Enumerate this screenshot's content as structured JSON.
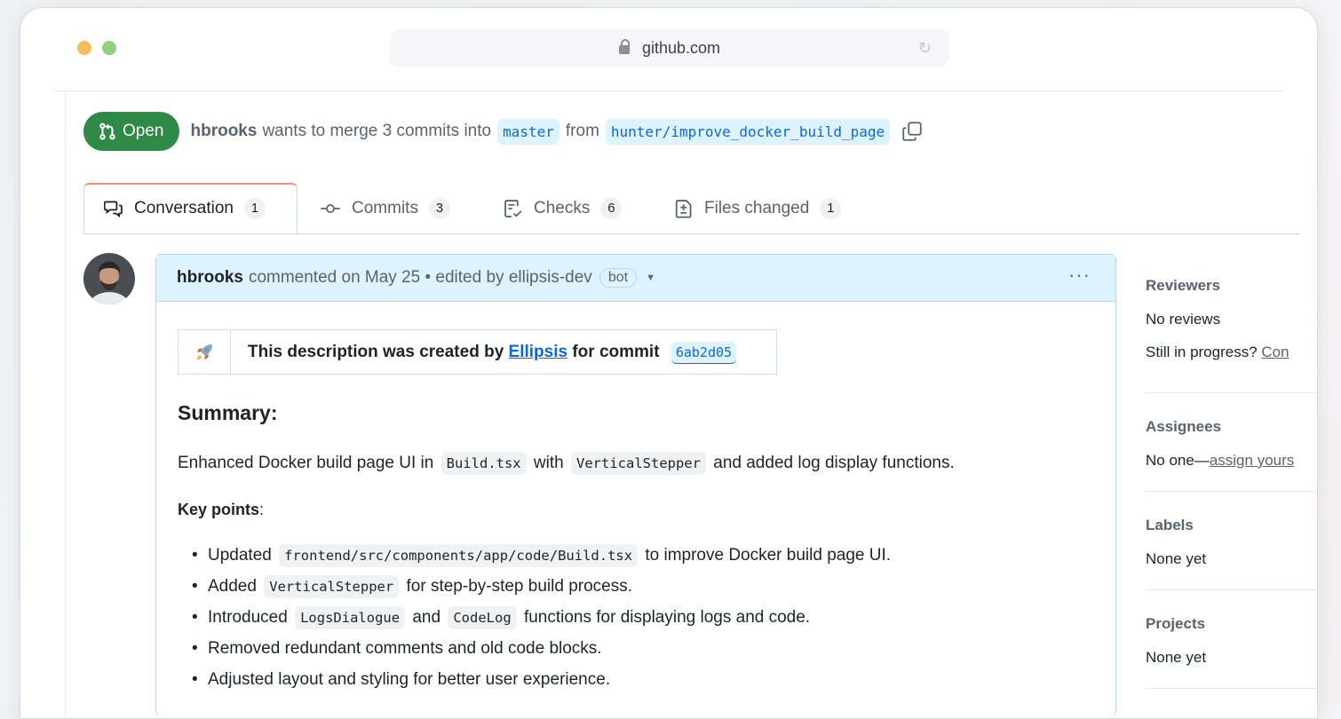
{
  "browser": {
    "url": "github.com"
  },
  "pr": {
    "state": "Open",
    "author": "hbrooks",
    "merge_text": "wants to merge 3 commits into",
    "base_branch": "master",
    "from_text": "from",
    "head_branch": "hunter/improve_docker_build_page"
  },
  "tabs": [
    {
      "label": "Conversation",
      "count": "1",
      "icon": "comment-discussion-icon"
    },
    {
      "label": "Commits",
      "count": "3",
      "icon": "git-commit-icon"
    },
    {
      "label": "Checks",
      "count": "6",
      "icon": "checklist-icon"
    },
    {
      "label": "Files changed",
      "count": "1",
      "icon": "file-diff-icon"
    }
  ],
  "comment": {
    "author": "hbrooks",
    "meta": "commented on May 25 • edited by ellipsis-dev",
    "bot_badge": "bot",
    "description": {
      "prefix": "This description was created by",
      "link": "Ellipsis",
      "middle": "for commit",
      "commit": "6ab2d05"
    },
    "summary_heading": "Summary:",
    "summary": {
      "t1": "Enhanced Docker build page UI in",
      "c1": "Build.tsx",
      "t2": "with",
      "c2": "VerticalStepper",
      "t3": "and added log display functions."
    },
    "key_points_heading": "Key points",
    "key_points_colon": ":",
    "bullets": [
      {
        "t1": "Updated",
        "c1": "frontend/src/components/app/code/Build.tsx",
        "t2": "to improve Docker build page UI."
      },
      {
        "t1": "Added",
        "c1": "VerticalStepper",
        "t2": "for step-by-step build process."
      },
      {
        "t1": "Introduced",
        "c1": "LogsDialogue",
        "t2": "and",
        "c2": "CodeLog",
        "t3": "functions for displaying logs and code."
      },
      {
        "t1": "Removed redundant comments and old code blocks."
      },
      {
        "t1": "Adjusted layout and styling for better user experience."
      }
    ]
  },
  "sidebar": {
    "reviewers": {
      "title": "Reviewers",
      "line1": "No reviews",
      "line2_text": "Still in progress?",
      "line2_link": "Con"
    },
    "assignees": {
      "title": "Assignees",
      "text": "No one—",
      "link": "assign yours"
    },
    "labels": {
      "title": "Labels",
      "text": "None yet"
    },
    "projects": {
      "title": "Projects",
      "text": "None yet"
    }
  },
  "colors": {
    "open_green": "#2e8a46",
    "link_blue": "#0969da",
    "header_blue_bg": "#ddf4ff",
    "active_tab_accent": "#fd8c73"
  }
}
